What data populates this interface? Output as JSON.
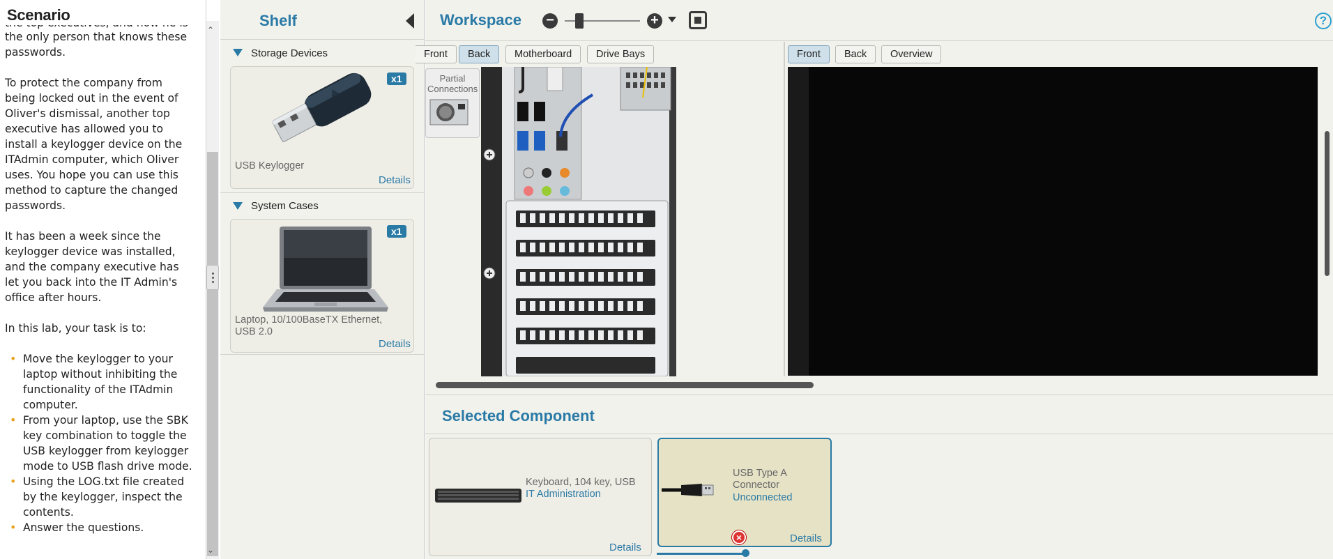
{
  "scenario": {
    "title": "Scenario",
    "clipped_line": "the top executives, and how he is",
    "paragraphs": [
      "the only person that knows these passwords.",
      "To protect the company from being locked out in the event of Oliver's dismissal, another top executive has allowed you to install a keylogger device on the ITAdmin computer, which Oliver uses. You hope you can use this method to capture the changed passwords.",
      "It has been a week since the keylogger device was installed, and the company executive has let you back into the IT Admin's office after hours.",
      "In this lab, your task is to:"
    ],
    "tasks": [
      "Move the keylogger to your laptop without inhibiting the functionality of the ITAdmin computer.",
      "From your laptop, use the SBK key combination to toggle the USB keylogger from keylogger mode to USB flash drive mode.",
      "Using the LOG.txt file created by the keylogger, inspect the contents.",
      "Answer the questions."
    ]
  },
  "shelf": {
    "title": "Shelf",
    "groups": [
      {
        "name": "Storage Devices",
        "item": {
          "label": "USB Keylogger",
          "count": "x1",
          "details": "Details"
        }
      },
      {
        "name": "System Cases",
        "item": {
          "label": "Laptop, 10/100BaseTX Ethernet, USB 2.0",
          "count": "x1",
          "details": "Details"
        }
      }
    ]
  },
  "workspace": {
    "title": "Workspace",
    "left_tabs": [
      "Front",
      "Back",
      "Motherboard",
      "Drive Bays"
    ],
    "left_active": "Back",
    "right_tabs": [
      "Front",
      "Back",
      "Overview"
    ],
    "right_active": "Front",
    "partial_connections": "Partial Connections",
    "help": "?"
  },
  "selected_component": {
    "title": "Selected Component",
    "cards": [
      {
        "name": "Keyboard, 104 key, USB",
        "status": "IT Administration",
        "details": "Details"
      },
      {
        "name": "USB Type A Connector",
        "status": "Unconnected",
        "details": "Details"
      }
    ]
  },
  "colors": {
    "accent": "#2a7aa6",
    "bullet": "#e8a21c",
    "selected_card": "#e6e2c6"
  }
}
